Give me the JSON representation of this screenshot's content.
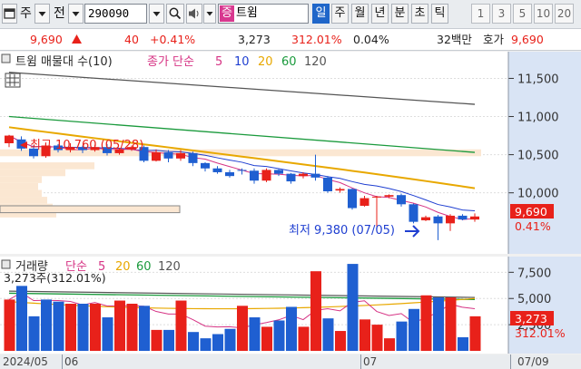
{
  "toolbar": {
    "market_label": "주",
    "type_label": "전",
    "code": "290090",
    "market_tag": "증",
    "name": "트윔",
    "periods": [
      {
        "label": "일",
        "active": true
      },
      {
        "label": "주",
        "active": false
      },
      {
        "label": "월",
        "active": false
      },
      {
        "label": "년",
        "active": false
      },
      {
        "label": "분",
        "active": false
      },
      {
        "label": "초",
        "active": false
      },
      {
        "label": "틱",
        "active": false
      }
    ],
    "intervals": [
      "1",
      "3",
      "5",
      "10",
      "20"
    ]
  },
  "quote": {
    "price": "9,690",
    "change": "40",
    "change_pct": "+0.41%",
    "volume": "3,273",
    "volume_ratio": "312.01%",
    "turnover": "0.04%",
    "trade_value": "32백만",
    "bid_label": "호가",
    "bid_price": "9,690"
  },
  "price_panel": {
    "title": "트윔 매물대 수(10)",
    "ma_label": "종가 단순",
    "ma_periods": [
      "5",
      "10",
      "20",
      "60",
      "120"
    ],
    "ma_colors": [
      "#d63384",
      "#1f3fd1",
      "#e8a800",
      "#1a9a3c",
      "#555555"
    ],
    "high_label": "최고 10,760 (05/28)",
    "low_label": "최저 9,380 (07/05)",
    "current_price_tag": "9,690",
    "current_change_tag": "0.41%"
  },
  "volume_panel": {
    "title": "거래량",
    "ma_label": "단순",
    "ma_periods": [
      "5",
      "20",
      "60",
      "120"
    ],
    "ma_colors": [
      "#d63384",
      "#e8a800",
      "#1a9a3c",
      "#555555"
    ],
    "current_label": "3,273주(312.01%)",
    "current_volume_tag": "3,273",
    "current_ratio_tag": "312.01%"
  },
  "date_axis": [
    "2024/05",
    "06",
    "07",
    "07/09"
  ],
  "chart_data": [
    {
      "type": "candlestick",
      "title": "트윔 매물대 수(10)",
      "yticks": [
        "11,500",
        "11,000",
        "10,500",
        "10,000"
      ],
      "ylim": [
        9200,
        11850
      ],
      "ohlc": [
        [
          10650,
          10760,
          10600,
          10750
        ],
        [
          10700,
          10740,
          10550,
          10580
        ],
        [
          10580,
          10620,
          10450,
          10480
        ],
        [
          10480,
          10660,
          10460,
          10620
        ],
        [
          10620,
          10640,
          10530,
          10560
        ],
        [
          10560,
          10650,
          10530,
          10600
        ],
        [
          10600,
          10620,
          10520,
          10560
        ],
        [
          10560,
          10630,
          10540,
          10600
        ],
        [
          10600,
          10640,
          10490,
          10520
        ],
        [
          10520,
          10590,
          10500,
          10570
        ],
        [
          10570,
          10620,
          10550,
          10600
        ],
        [
          10600,
          10620,
          10400,
          10420
        ],
        [
          10420,
          10570,
          10410,
          10530
        ],
        [
          10530,
          10560,
          10400,
          10450
        ],
        [
          10450,
          10560,
          10420,
          10520
        ],
        [
          10520,
          10540,
          10350,
          10390
        ],
        [
          10390,
          10400,
          10280,
          10320
        ],
        [
          10320,
          10350,
          10250,
          10270
        ],
        [
          10270,
          10300,
          10200,
          10220
        ],
        [
          10300,
          10320,
          10240,
          10290
        ],
        [
          10290,
          10320,
          10120,
          10160
        ],
        [
          10160,
          10320,
          10140,
          10300
        ],
        [
          10300,
          10310,
          10220,
          10250
        ],
        [
          10250,
          10260,
          10120,
          10150
        ],
        [
          10220,
          10270,
          10190,
          10250
        ],
        [
          10250,
          10500,
          10160,
          10200
        ],
        [
          10200,
          10220,
          10000,
          10020
        ],
        [
          10030,
          10070,
          10000,
          10050
        ],
        [
          10050,
          10060,
          9780,
          9800
        ],
        [
          9830,
          9960,
          9820,
          9930
        ],
        [
          9940,
          9960,
          9560,
          9950
        ],
        [
          9950,
          9980,
          9930,
          9970
        ],
        [
          9970,
          9990,
          9820,
          9850
        ],
        [
          9850,
          9860,
          9600,
          9620
        ],
        [
          9640,
          9700,
          9630,
          9680
        ],
        [
          9690,
          9710,
          9380,
          9600
        ],
        [
          9600,
          9720,
          9500,
          9700
        ],
        [
          9700,
          9720,
          9640,
          9650
        ],
        [
          9650,
          9730,
          9620,
          9690
        ]
      ],
      "volume_profile": [
        0.31,
        0.29,
        0.26,
        0.23,
        0.21,
        0.23,
        0.36,
        0.52,
        0.99,
        0.97
      ]
    },
    {
      "type": "bar",
      "title": "거래량",
      "yticks": [
        "7,500",
        "5,000",
        "2,500"
      ],
      "ylim": [
        0,
        9000
      ],
      "values": [
        4900,
        6200,
        3300,
        4900,
        4700,
        4500,
        4500,
        4500,
        3200,
        4800,
        4500,
        4300,
        2000,
        2000,
        4800,
        1800,
        1200,
        1600,
        2100,
        4300,
        3200,
        2300,
        2900,
        4200,
        2300,
        7600,
        3100,
        1900,
        8300,
        3000,
        2500,
        1200,
        2800,
        4000,
        5300,
        5100,
        5100,
        1300,
        3300
      ],
      "up": [
        true,
        false,
        false,
        false,
        false,
        true,
        false,
        true,
        false,
        true,
        true,
        false,
        true,
        false,
        true,
        false,
        false,
        false,
        false,
        true,
        false,
        true,
        false,
        false,
        true,
        true,
        false,
        true,
        false,
        true,
        true,
        true,
        false,
        false,
        true,
        false,
        true,
        false,
        true
      ]
    }
  ]
}
